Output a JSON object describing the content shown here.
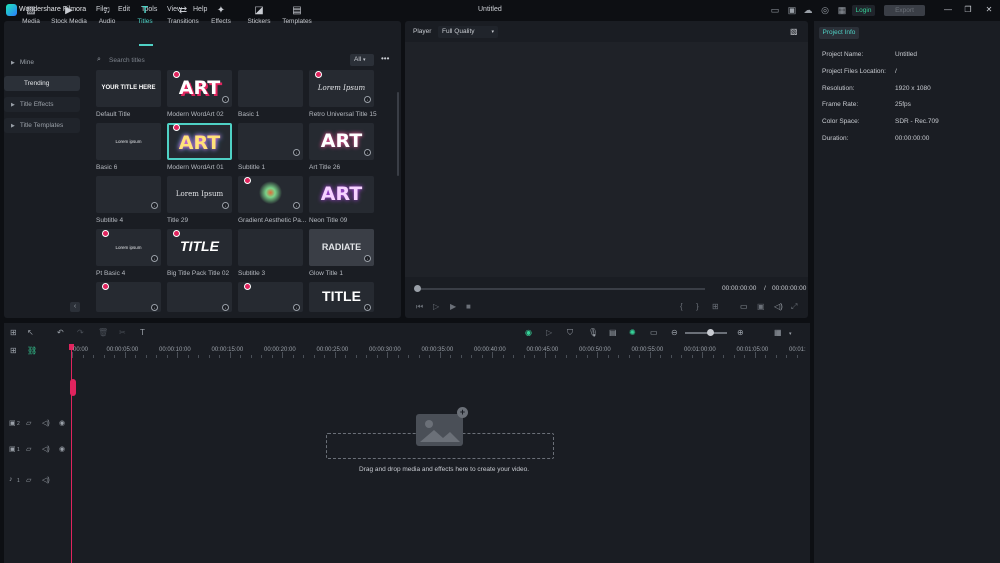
{
  "app": {
    "name": "Wondershare Filmora",
    "doc_title": "Untitled"
  },
  "menu": [
    "File",
    "Edit",
    "Tools",
    "View",
    "Help"
  ],
  "titlebar": {
    "login": "Login",
    "export": "Export"
  },
  "tabs": [
    {
      "label": "Media",
      "icon": "media-icon"
    },
    {
      "label": "Stock Media",
      "icon": "stock-media-icon"
    },
    {
      "label": "Audio",
      "icon": "audio-icon"
    },
    {
      "label": "Titles",
      "icon": "titles-icon"
    },
    {
      "label": "Transitions",
      "icon": "transitions-icon"
    },
    {
      "label": "Effects",
      "icon": "effects-icon"
    },
    {
      "label": "Stickers",
      "icon": "stickers-icon"
    },
    {
      "label": "Templates",
      "icon": "templates-icon"
    }
  ],
  "active_tab": "Titles",
  "sidebar": {
    "items": [
      "Mine",
      "Trending",
      "Title Effects",
      "Title Templates"
    ],
    "selected": "Trending"
  },
  "search": {
    "placeholder": "Search titles",
    "filter": "All"
  },
  "titles": [
    {
      "label": "Default Title",
      "thumb_text": "YOUR TITLE HERE"
    },
    {
      "label": "Modern WordArt 02",
      "thumb_text": "ART"
    },
    {
      "label": "Basic 1",
      "thumb_text": ""
    },
    {
      "label": "Retro Universal Title 15",
      "thumb_text": "Lorem Ipsum"
    },
    {
      "label": "Basic 6",
      "thumb_text": "Lorem ipsum"
    },
    {
      "label": "Modern WordArt 01",
      "thumb_text": "ART"
    },
    {
      "label": "Subtitle 1",
      "thumb_text": ""
    },
    {
      "label": "Art Title 26",
      "thumb_text": "ART"
    },
    {
      "label": "Subtitle 4",
      "thumb_text": ""
    },
    {
      "label": "Title 29",
      "thumb_text": "Lorem Ipsum"
    },
    {
      "label": "Gradient Aesthetic Pa...",
      "thumb_text": ""
    },
    {
      "label": "Neon Title 09",
      "thumb_text": "ART"
    },
    {
      "label": "Pt Basic 4",
      "thumb_text": "Lorem ipsum"
    },
    {
      "label": "Big Title Pack Title 02",
      "thumb_text": "TITLE"
    },
    {
      "label": "Subtitle 3",
      "thumb_text": ""
    },
    {
      "label": "Glow Title 1",
      "thumb_text": "RADIATE"
    },
    {
      "label": "",
      "thumb_text": ""
    },
    {
      "label": "",
      "thumb_text": ""
    },
    {
      "label": "",
      "thumb_text": ""
    },
    {
      "label": "",
      "thumb_text": "TITLE"
    }
  ],
  "player": {
    "label": "Player",
    "quality": "Full Quality",
    "time_current": "00:00:00:00",
    "time_separator": "/",
    "time_total": "00:00:00:00"
  },
  "project_info": {
    "tab": "Project Info",
    "rows": [
      {
        "key": "Project Name:",
        "value": "Untitled"
      },
      {
        "key": "Project Files Location:",
        "value": "/"
      },
      {
        "key": "Resolution:",
        "value": "1920 x 1080"
      },
      {
        "key": "Frame Rate:",
        "value": "25fps"
      },
      {
        "key": "Color Space:",
        "value": "SDR - Rec.709"
      },
      {
        "key": "Duration:",
        "value": "00:00:00:00"
      }
    ]
  },
  "timeline": {
    "ruler": [
      "00:00",
      "00:00:05:00",
      "00:00:10:00",
      "00:00:15:00",
      "00:00:20:00",
      "00:00:25:00",
      "00:00:30:00",
      "00:00:35:00",
      "00:00:40:00",
      "00:00:45:00",
      "00:00:50:00",
      "00:00:55:00",
      "00:01:00:00",
      "00:01:05:00",
      "00:01:"
    ],
    "drop_text": "Drag and drop media and effects here to create your video.",
    "tracks": [
      "2",
      "1",
      "1"
    ]
  },
  "colors": {
    "accent": "#4fd1c5",
    "playhead": "#e0245e",
    "login": "#36d399"
  }
}
